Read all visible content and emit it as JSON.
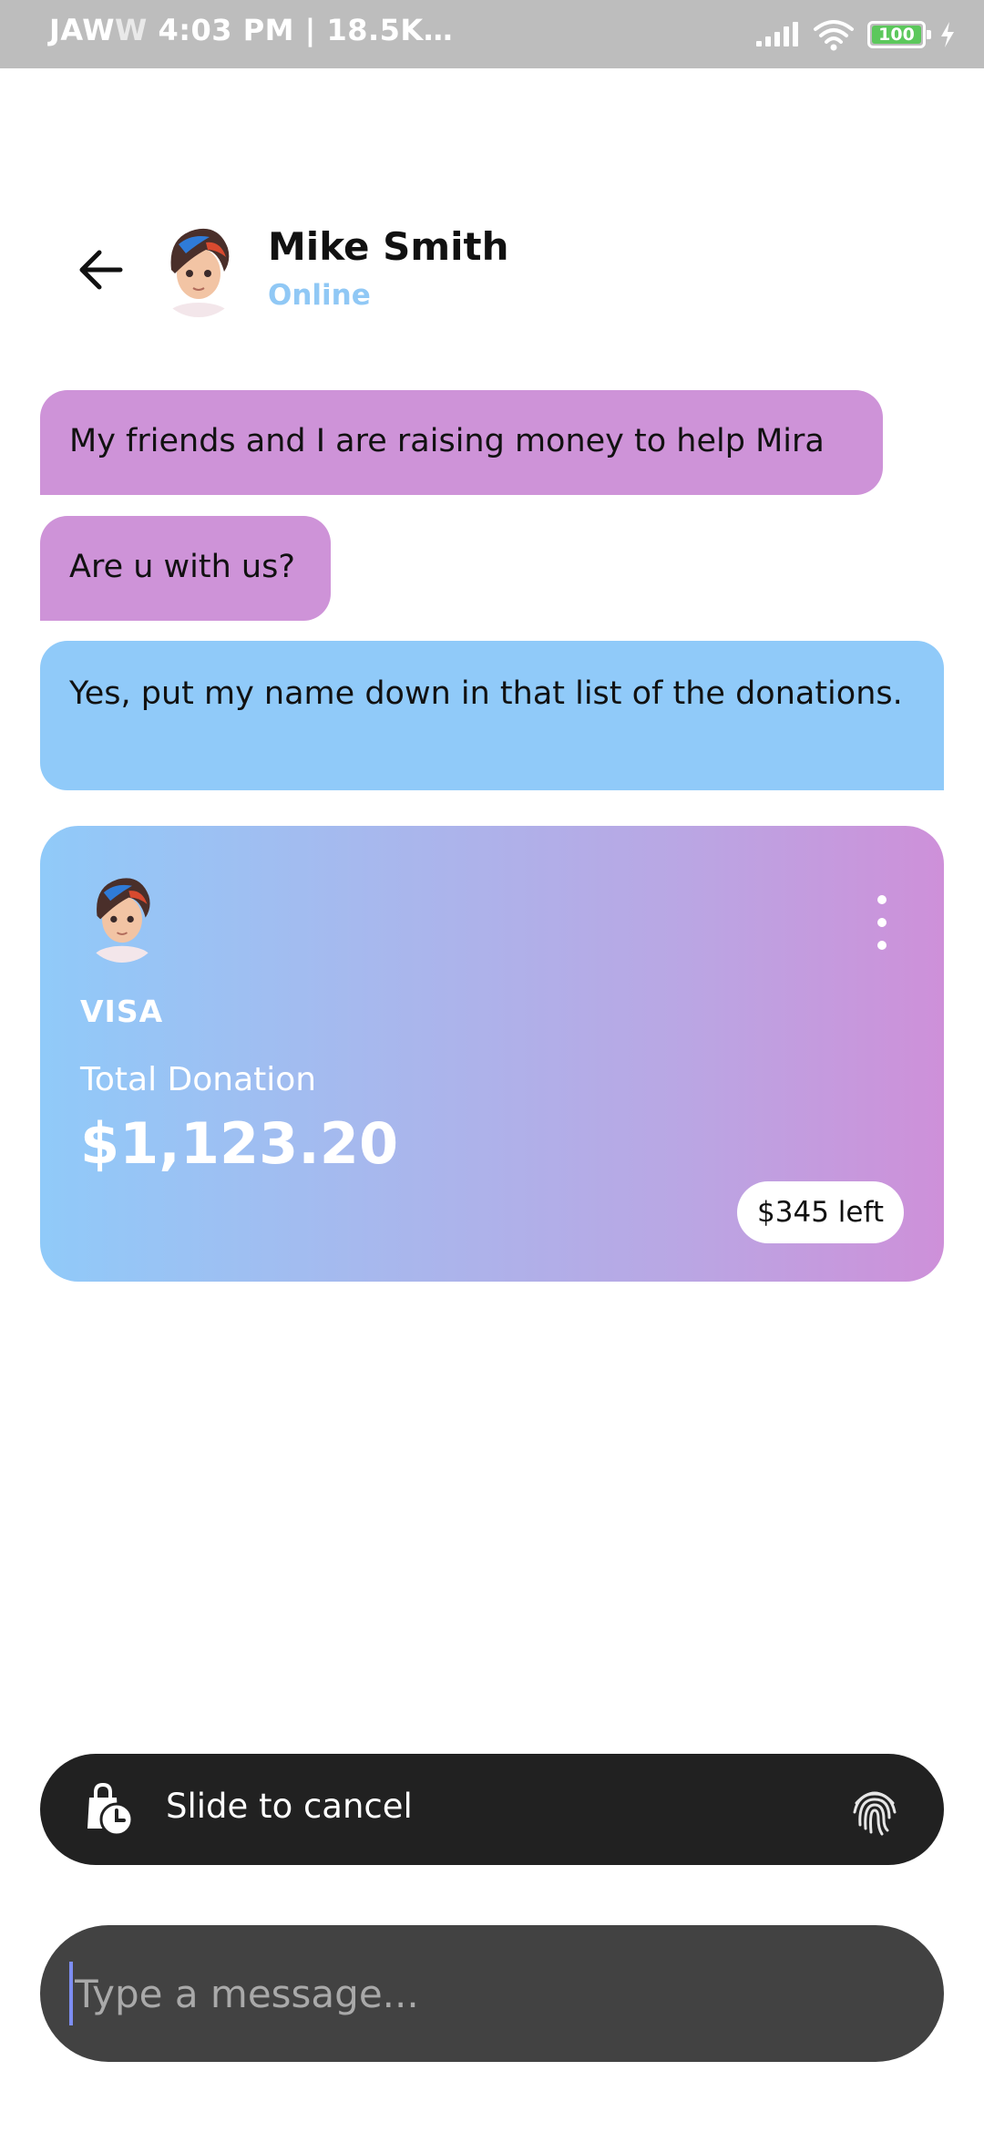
{
  "status_bar": {
    "carrier": "JAW",
    "carrier_dim": "W",
    "info": "4:03 PM | 18.5K…",
    "battery": "100",
    "icons": [
      "signal-icon",
      "wifi-icon",
      "battery-icon",
      "charging-icon"
    ]
  },
  "header": {
    "back_icon": "arrow-left-icon",
    "name": "Mike Smith",
    "status": "Online"
  },
  "messages": [
    {
      "text": "My friends and I are raising money to help Mira",
      "sender": "contact"
    },
    {
      "text": "Are u with us?",
      "sender": "contact"
    },
    {
      "text": "Yes, put my name down in that list of the donations.",
      "sender": "me"
    }
  ],
  "donation_card": {
    "brand": "VISA",
    "label": "Total Donation",
    "amount": "$1,123.20",
    "remaining": "$345 left",
    "menu_icon": "more-vertical-icon"
  },
  "recording": {
    "text": "Slide to cancel",
    "left_icon": "bag-clock-icon",
    "right_icon": "fingerprint-icon"
  },
  "composer": {
    "placeholder": "Type a message..."
  },
  "colors": {
    "incoming_bubble": "#ce93d8",
    "outgoing_bubble": "#90caf9",
    "status_online": "#90c8f5",
    "record_bar": "#212121",
    "input_bg": "#424242"
  }
}
